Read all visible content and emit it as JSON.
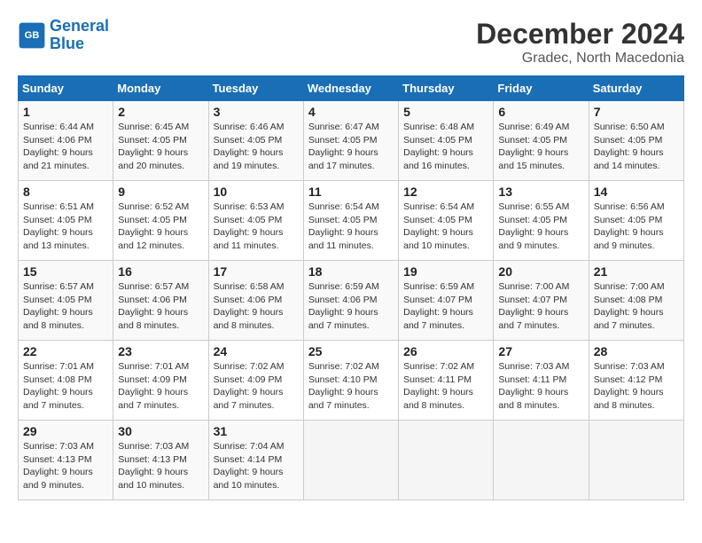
{
  "header": {
    "logo_line1": "General",
    "logo_line2": "Blue",
    "month": "December 2024",
    "location": "Gradec, North Macedonia"
  },
  "weekdays": [
    "Sunday",
    "Monday",
    "Tuesday",
    "Wednesday",
    "Thursday",
    "Friday",
    "Saturday"
  ],
  "weeks": [
    [
      {
        "day": "1",
        "info": "Sunrise: 6:44 AM\nSunset: 4:06 PM\nDaylight: 9 hours\nand 21 minutes."
      },
      {
        "day": "2",
        "info": "Sunrise: 6:45 AM\nSunset: 4:05 PM\nDaylight: 9 hours\nand 20 minutes."
      },
      {
        "day": "3",
        "info": "Sunrise: 6:46 AM\nSunset: 4:05 PM\nDaylight: 9 hours\nand 19 minutes."
      },
      {
        "day": "4",
        "info": "Sunrise: 6:47 AM\nSunset: 4:05 PM\nDaylight: 9 hours\nand 17 minutes."
      },
      {
        "day": "5",
        "info": "Sunrise: 6:48 AM\nSunset: 4:05 PM\nDaylight: 9 hours\nand 16 minutes."
      },
      {
        "day": "6",
        "info": "Sunrise: 6:49 AM\nSunset: 4:05 PM\nDaylight: 9 hours\nand 15 minutes."
      },
      {
        "day": "7",
        "info": "Sunrise: 6:50 AM\nSunset: 4:05 PM\nDaylight: 9 hours\nand 14 minutes."
      }
    ],
    [
      {
        "day": "8",
        "info": "Sunrise: 6:51 AM\nSunset: 4:05 PM\nDaylight: 9 hours\nand 13 minutes."
      },
      {
        "day": "9",
        "info": "Sunrise: 6:52 AM\nSunset: 4:05 PM\nDaylight: 9 hours\nand 12 minutes."
      },
      {
        "day": "10",
        "info": "Sunrise: 6:53 AM\nSunset: 4:05 PM\nDaylight: 9 hours\nand 11 minutes."
      },
      {
        "day": "11",
        "info": "Sunrise: 6:54 AM\nSunset: 4:05 PM\nDaylight: 9 hours\nand 11 minutes."
      },
      {
        "day": "12",
        "info": "Sunrise: 6:54 AM\nSunset: 4:05 PM\nDaylight: 9 hours\nand 10 minutes."
      },
      {
        "day": "13",
        "info": "Sunrise: 6:55 AM\nSunset: 4:05 PM\nDaylight: 9 hours\nand 9 minutes."
      },
      {
        "day": "14",
        "info": "Sunrise: 6:56 AM\nSunset: 4:05 PM\nDaylight: 9 hours\nand 9 minutes."
      }
    ],
    [
      {
        "day": "15",
        "info": "Sunrise: 6:57 AM\nSunset: 4:05 PM\nDaylight: 9 hours\nand 8 minutes."
      },
      {
        "day": "16",
        "info": "Sunrise: 6:57 AM\nSunset: 4:06 PM\nDaylight: 9 hours\nand 8 minutes."
      },
      {
        "day": "17",
        "info": "Sunrise: 6:58 AM\nSunset: 4:06 PM\nDaylight: 9 hours\nand 8 minutes."
      },
      {
        "day": "18",
        "info": "Sunrise: 6:59 AM\nSunset: 4:06 PM\nDaylight: 9 hours\nand 7 minutes."
      },
      {
        "day": "19",
        "info": "Sunrise: 6:59 AM\nSunset: 4:07 PM\nDaylight: 9 hours\nand 7 minutes."
      },
      {
        "day": "20",
        "info": "Sunrise: 7:00 AM\nSunset: 4:07 PM\nDaylight: 9 hours\nand 7 minutes."
      },
      {
        "day": "21",
        "info": "Sunrise: 7:00 AM\nSunset: 4:08 PM\nDaylight: 9 hours\nand 7 minutes."
      }
    ],
    [
      {
        "day": "22",
        "info": "Sunrise: 7:01 AM\nSunset: 4:08 PM\nDaylight: 9 hours\nand 7 minutes."
      },
      {
        "day": "23",
        "info": "Sunrise: 7:01 AM\nSunset: 4:09 PM\nDaylight: 9 hours\nand 7 minutes."
      },
      {
        "day": "24",
        "info": "Sunrise: 7:02 AM\nSunset: 4:09 PM\nDaylight: 9 hours\nand 7 minutes."
      },
      {
        "day": "25",
        "info": "Sunrise: 7:02 AM\nSunset: 4:10 PM\nDaylight: 9 hours\nand 7 minutes."
      },
      {
        "day": "26",
        "info": "Sunrise: 7:02 AM\nSunset: 4:11 PM\nDaylight: 9 hours\nand 8 minutes."
      },
      {
        "day": "27",
        "info": "Sunrise: 7:03 AM\nSunset: 4:11 PM\nDaylight: 9 hours\nand 8 minutes."
      },
      {
        "day": "28",
        "info": "Sunrise: 7:03 AM\nSunset: 4:12 PM\nDaylight: 9 hours\nand 8 minutes."
      }
    ],
    [
      {
        "day": "29",
        "info": "Sunrise: 7:03 AM\nSunset: 4:13 PM\nDaylight: 9 hours\nand 9 minutes."
      },
      {
        "day": "30",
        "info": "Sunrise: 7:03 AM\nSunset: 4:13 PM\nDaylight: 9 hours\nand 10 minutes."
      },
      {
        "day": "31",
        "info": "Sunrise: 7:04 AM\nSunset: 4:14 PM\nDaylight: 9 hours\nand 10 minutes."
      },
      null,
      null,
      null,
      null
    ]
  ]
}
